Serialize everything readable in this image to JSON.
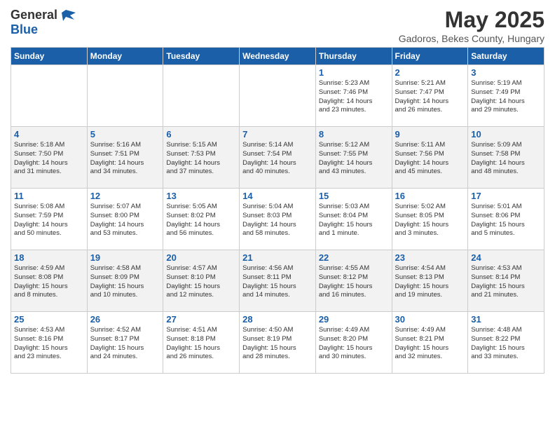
{
  "header": {
    "logo_general": "General",
    "logo_blue": "Blue",
    "month_title": "May 2025",
    "subtitle": "Gadoros, Bekes County, Hungary"
  },
  "days_of_week": [
    "Sunday",
    "Monday",
    "Tuesday",
    "Wednesday",
    "Thursday",
    "Friday",
    "Saturday"
  ],
  "weeks": [
    [
      {
        "day": "",
        "info": ""
      },
      {
        "day": "",
        "info": ""
      },
      {
        "day": "",
        "info": ""
      },
      {
        "day": "",
        "info": ""
      },
      {
        "day": "1",
        "info": "Sunrise: 5:23 AM\nSunset: 7:46 PM\nDaylight: 14 hours\nand 23 minutes."
      },
      {
        "day": "2",
        "info": "Sunrise: 5:21 AM\nSunset: 7:47 PM\nDaylight: 14 hours\nand 26 minutes."
      },
      {
        "day": "3",
        "info": "Sunrise: 5:19 AM\nSunset: 7:49 PM\nDaylight: 14 hours\nand 29 minutes."
      }
    ],
    [
      {
        "day": "4",
        "info": "Sunrise: 5:18 AM\nSunset: 7:50 PM\nDaylight: 14 hours\nand 31 minutes."
      },
      {
        "day": "5",
        "info": "Sunrise: 5:16 AM\nSunset: 7:51 PM\nDaylight: 14 hours\nand 34 minutes."
      },
      {
        "day": "6",
        "info": "Sunrise: 5:15 AM\nSunset: 7:53 PM\nDaylight: 14 hours\nand 37 minutes."
      },
      {
        "day": "7",
        "info": "Sunrise: 5:14 AM\nSunset: 7:54 PM\nDaylight: 14 hours\nand 40 minutes."
      },
      {
        "day": "8",
        "info": "Sunrise: 5:12 AM\nSunset: 7:55 PM\nDaylight: 14 hours\nand 43 minutes."
      },
      {
        "day": "9",
        "info": "Sunrise: 5:11 AM\nSunset: 7:56 PM\nDaylight: 14 hours\nand 45 minutes."
      },
      {
        "day": "10",
        "info": "Sunrise: 5:09 AM\nSunset: 7:58 PM\nDaylight: 14 hours\nand 48 minutes."
      }
    ],
    [
      {
        "day": "11",
        "info": "Sunrise: 5:08 AM\nSunset: 7:59 PM\nDaylight: 14 hours\nand 50 minutes."
      },
      {
        "day": "12",
        "info": "Sunrise: 5:07 AM\nSunset: 8:00 PM\nDaylight: 14 hours\nand 53 minutes."
      },
      {
        "day": "13",
        "info": "Sunrise: 5:05 AM\nSunset: 8:02 PM\nDaylight: 14 hours\nand 56 minutes."
      },
      {
        "day": "14",
        "info": "Sunrise: 5:04 AM\nSunset: 8:03 PM\nDaylight: 14 hours\nand 58 minutes."
      },
      {
        "day": "15",
        "info": "Sunrise: 5:03 AM\nSunset: 8:04 PM\nDaylight: 15 hours\nand 1 minute."
      },
      {
        "day": "16",
        "info": "Sunrise: 5:02 AM\nSunset: 8:05 PM\nDaylight: 15 hours\nand 3 minutes."
      },
      {
        "day": "17",
        "info": "Sunrise: 5:01 AM\nSunset: 8:06 PM\nDaylight: 15 hours\nand 5 minutes."
      }
    ],
    [
      {
        "day": "18",
        "info": "Sunrise: 4:59 AM\nSunset: 8:08 PM\nDaylight: 15 hours\nand 8 minutes."
      },
      {
        "day": "19",
        "info": "Sunrise: 4:58 AM\nSunset: 8:09 PM\nDaylight: 15 hours\nand 10 minutes."
      },
      {
        "day": "20",
        "info": "Sunrise: 4:57 AM\nSunset: 8:10 PM\nDaylight: 15 hours\nand 12 minutes."
      },
      {
        "day": "21",
        "info": "Sunrise: 4:56 AM\nSunset: 8:11 PM\nDaylight: 15 hours\nand 14 minutes."
      },
      {
        "day": "22",
        "info": "Sunrise: 4:55 AM\nSunset: 8:12 PM\nDaylight: 15 hours\nand 16 minutes."
      },
      {
        "day": "23",
        "info": "Sunrise: 4:54 AM\nSunset: 8:13 PM\nDaylight: 15 hours\nand 19 minutes."
      },
      {
        "day": "24",
        "info": "Sunrise: 4:53 AM\nSunset: 8:14 PM\nDaylight: 15 hours\nand 21 minutes."
      }
    ],
    [
      {
        "day": "25",
        "info": "Sunrise: 4:53 AM\nSunset: 8:16 PM\nDaylight: 15 hours\nand 23 minutes."
      },
      {
        "day": "26",
        "info": "Sunrise: 4:52 AM\nSunset: 8:17 PM\nDaylight: 15 hours\nand 24 minutes."
      },
      {
        "day": "27",
        "info": "Sunrise: 4:51 AM\nSunset: 8:18 PM\nDaylight: 15 hours\nand 26 minutes."
      },
      {
        "day": "28",
        "info": "Sunrise: 4:50 AM\nSunset: 8:19 PM\nDaylight: 15 hours\nand 28 minutes."
      },
      {
        "day": "29",
        "info": "Sunrise: 4:49 AM\nSunset: 8:20 PM\nDaylight: 15 hours\nand 30 minutes."
      },
      {
        "day": "30",
        "info": "Sunrise: 4:49 AM\nSunset: 8:21 PM\nDaylight: 15 hours\nand 32 minutes."
      },
      {
        "day": "31",
        "info": "Sunrise: 4:48 AM\nSunset: 8:22 PM\nDaylight: 15 hours\nand 33 minutes."
      }
    ]
  ]
}
